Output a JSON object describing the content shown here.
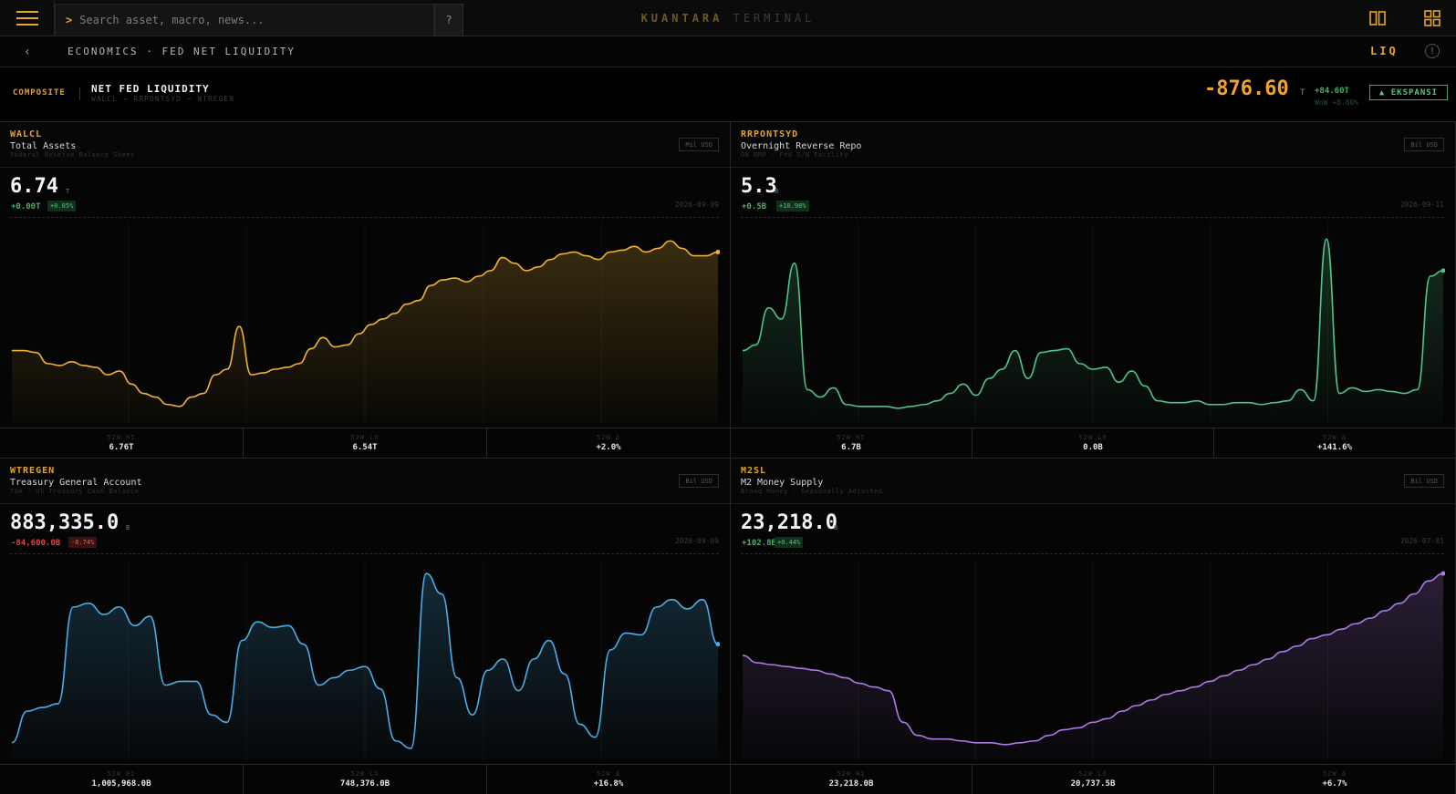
{
  "header": {
    "search_placeholder": "Search asset, macro, news...",
    "search_prompt": ">",
    "help_label": "?",
    "brand_primary": "KUANTARA",
    "brand_secondary": "TERMINAL"
  },
  "breadcrumb": {
    "back_label": "‹",
    "path": "ECONOMICS · FED NET LIQUIDITY",
    "right_tag": "LIQ",
    "info_label": "!"
  },
  "composite": {
    "tag": "COMPOSITE",
    "title": "NET FED LIQUIDITY",
    "subtitle": "WALCL − RRPONTSYD − WTREGEN",
    "value": "-876.60",
    "unit": "T",
    "change": "+84.60T",
    "wow": "WoW +8.80%",
    "badge": "▲ EKSPANSI"
  },
  "colors": {
    "accent": "#e6a52a",
    "walcl": "#f0b432",
    "rrp": "#4fc489",
    "tga": "#4aaee8",
    "m2": "#b07ae6",
    "up": "#4caf6a",
    "down": "#e04545"
  },
  "icons": {
    "menu": "menu-icon",
    "columns": "columns-icon",
    "grid": "grid-icon",
    "back": "chevron-left-icon",
    "info": "info-icon"
  },
  "panels": [
    {
      "code": "WALCL",
      "name": "Total Assets",
      "desc": "Federal Reserve Balance Sheet",
      "unit_badge": "Mil USD",
      "value": "6.74",
      "value_unit": "T",
      "change": "+0.00T",
      "pct": "+0.05%",
      "direction": "up",
      "date": "2026-09-09",
      "stats": [
        {
          "label": "52W HI",
          "value": "6.76T"
        },
        {
          "label": "52W LO",
          "value": "6.54T"
        },
        {
          "label": "52W Δ",
          "value": "+2.0%"
        }
      ]
    },
    {
      "code": "RRPONTSYD",
      "name": "Overnight Reverse Repo",
      "desc": "ON RRP · Fed O/N Facility",
      "unit_badge": "Bil USD",
      "value": "5.3",
      "value_unit": "B",
      "change": "+0.5B",
      "pct": "+10.96%",
      "direction": "up",
      "date": "2026-09-11",
      "stats": [
        {
          "label": "52W HI",
          "value": "6.7B"
        },
        {
          "label": "52W LO",
          "value": "0.0B"
        },
        {
          "label": "52W Δ",
          "value": "+141.6%"
        }
      ]
    },
    {
      "code": "WTREGEN",
      "name": "Treasury General Account",
      "desc": "TGA · US Treasury Cash Balance",
      "unit_badge": "Bil USD",
      "value": "883,335.0",
      "value_unit": "B",
      "change": "-84,600.0B",
      "pct": "-8.74%",
      "direction": "down",
      "date": "2026-09-09",
      "stats": [
        {
          "label": "52W HI",
          "value": "1,005,968.0B"
        },
        {
          "label": "52W LO",
          "value": "748,376.0B"
        },
        {
          "label": "52W Δ",
          "value": "+16.8%"
        }
      ]
    },
    {
      "code": "M2SL",
      "name": "M2 Money Supply",
      "desc": "Broad Money · Seasonally Adjusted",
      "unit_badge": "Bil USD",
      "value": "23,218.0",
      "value_unit": "B",
      "change": "+102.8B",
      "pct": "+0.44%",
      "direction": "up",
      "date": "2026-07-01",
      "stats": [
        {
          "label": "52W HI",
          "value": "23,218.0B"
        },
        {
          "label": "52W LO",
          "value": "20,737.5B"
        },
        {
          "label": "52W Δ",
          "value": "+6.7%"
        }
      ]
    }
  ]
}
